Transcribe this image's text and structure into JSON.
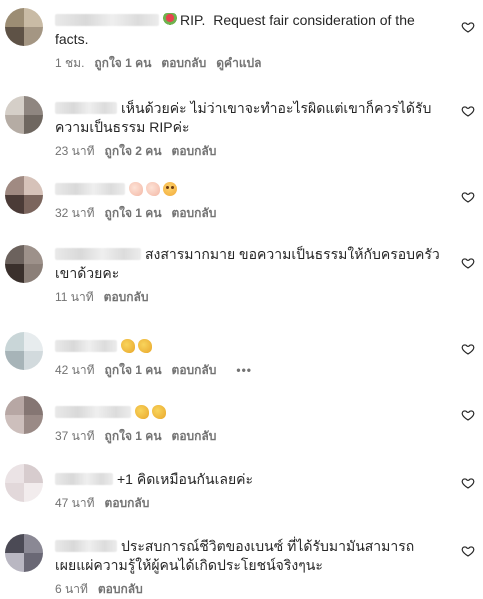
{
  "actions": {
    "like": "ถูกใจ 1 คน",
    "reply": "ตอบกลับ",
    "translate": "ดูคำแปล",
    "more": "•••"
  },
  "comments": [
    {
      "text": "RIP.  Request fair consideration of the facts.",
      "time": "1 ชม.",
      "likes": "ถูกใจ 1 คน",
      "translate": "ดูคำแปล",
      "emoji_before": [
        "rose-icon"
      ],
      "emoji_mid": [
        "rose-icon"
      ]
    },
    {
      "text": "เห็นด้วยค่ะ ไม่ว่าเขาจะทำอะไรผิดแต่เขาก็ควรได้รับความเป็นธรรม RIPค่ะ",
      "time": "23 นาที",
      "likes": "ถูกใจ 2 คน"
    },
    {
      "text": "",
      "time": "32 นาที",
      "likes": "ถูกใจ 1 คน",
      "emojis": [
        "hand-icon",
        "hand-icon",
        "face-icon"
      ]
    },
    {
      "text": "สงสารมากมาย ขอความเป็นธรรมให้กับครอบครัว เขาด้วยคะ",
      "time": "11 นาที"
    },
    {
      "text": "",
      "time": "42 นาที",
      "likes": "ถูกใจ 1 คน",
      "emojis": [
        "clap-icon",
        "clap-icon"
      ],
      "more": "•••"
    },
    {
      "text": "",
      "time": "37 นาที",
      "likes": "ถูกใจ 1 คน",
      "emojis": [
        "clap-icon",
        "clap-icon"
      ]
    },
    {
      "text": "+1 คิดเหมือนกันเลยค่ะ",
      "time": "47 นาที"
    },
    {
      "text": "ประสบการณ์ชีวิตของเบนซ์ ที่ได้รับมามันสามารถเผยแผ่ความรู้ให้ผู้คนได้เกิดประโยชน์จริงๆนะ",
      "time": "6 นาที"
    }
  ],
  "colors": {
    "text": "#262626",
    "meta": "#737373",
    "background": "#ffffff"
  }
}
